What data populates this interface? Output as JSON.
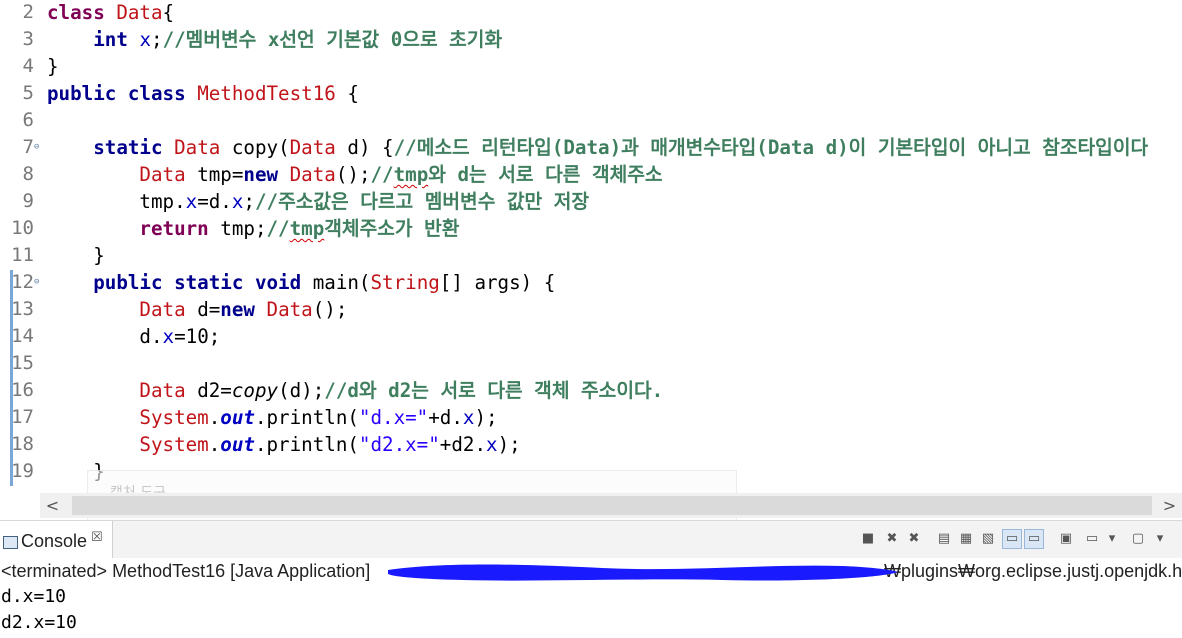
{
  "editor": {
    "lines": [
      {
        "num": "2",
        "parts": [
          {
            "t": "class ",
            "c": "kw"
          },
          {
            "t": "Data",
            "c": "ty"
          },
          {
            "t": "{",
            "c": ""
          }
        ]
      },
      {
        "num": "3",
        "parts": [
          {
            "t": "    ",
            "c": ""
          },
          {
            "t": "int",
            "c": "kwb"
          },
          {
            "t": " ",
            "c": ""
          },
          {
            "t": "x",
            "c": "fld"
          },
          {
            "t": ";",
            "c": ""
          },
          {
            "t": "//멤버변수 x선언 기본값 0으로 초기화",
            "c": "cm"
          }
        ]
      },
      {
        "num": "4",
        "parts": [
          {
            "t": "}",
            "c": ""
          }
        ]
      },
      {
        "num": "5",
        "parts": [
          {
            "t": "public class ",
            "c": "kwb"
          },
          {
            "t": "MethodTest16",
            "c": "ty"
          },
          {
            "t": " {",
            "c": ""
          }
        ]
      },
      {
        "num": "6",
        "parts": []
      },
      {
        "num": "7",
        "fold": true,
        "parts": [
          {
            "t": "    ",
            "c": ""
          },
          {
            "t": "static ",
            "c": "kwb"
          },
          {
            "t": "Data",
            "c": "ty"
          },
          {
            "t": " copy(",
            "c": ""
          },
          {
            "t": "Data",
            "c": "ty"
          },
          {
            "t": " d) {",
            "c": ""
          },
          {
            "t": "//메소드 리턴타입(Data)과 매개변수타입(Data d)이 기본타입이 아니고 참조타입이다",
            "c": "cm"
          }
        ]
      },
      {
        "num": "8",
        "parts": [
          {
            "t": "        ",
            "c": ""
          },
          {
            "t": "Data",
            "c": "ty"
          },
          {
            "t": " tmp=",
            "c": ""
          },
          {
            "t": "new ",
            "c": "kwb"
          },
          {
            "t": "Data",
            "c": "ty"
          },
          {
            "t": "();",
            "c": ""
          },
          {
            "t": "//",
            "c": "cm"
          },
          {
            "t": "tmp",
            "c": "cm squig"
          },
          {
            "t": "와 d는 서로 다른 객체주소",
            "c": "cm"
          }
        ]
      },
      {
        "num": "9",
        "parts": [
          {
            "t": "        tmp.",
            "c": ""
          },
          {
            "t": "x",
            "c": "fld"
          },
          {
            "t": "=d.",
            "c": ""
          },
          {
            "t": "x",
            "c": "fld"
          },
          {
            "t": ";",
            "c": ""
          },
          {
            "t": "//주소값은 다르고 멤버변수 값만 저장",
            "c": "cm"
          }
        ]
      },
      {
        "num": "10",
        "parts": [
          {
            "t": "        ",
            "c": ""
          },
          {
            "t": "return",
            "c": "kw"
          },
          {
            "t": " tmp;",
            "c": ""
          },
          {
            "t": "//",
            "c": "cm"
          },
          {
            "t": "tmp",
            "c": "cm squig"
          },
          {
            "t": "객체주소가 반환",
            "c": "cm"
          }
        ]
      },
      {
        "num": "11",
        "parts": [
          {
            "t": "    }",
            "c": ""
          }
        ]
      },
      {
        "num": "12",
        "fold": true,
        "parts": [
          {
            "t": "    ",
            "c": ""
          },
          {
            "t": "public static void ",
            "c": "kwb"
          },
          {
            "t": "main(",
            "c": ""
          },
          {
            "t": "String",
            "c": "ty"
          },
          {
            "t": "[] args) {",
            "c": ""
          }
        ]
      },
      {
        "num": "13",
        "parts": [
          {
            "t": "        ",
            "c": ""
          },
          {
            "t": "Data",
            "c": "ty"
          },
          {
            "t": " d=",
            "c": ""
          },
          {
            "t": "new ",
            "c": "kwb"
          },
          {
            "t": "Data",
            "c": "ty"
          },
          {
            "t": "();",
            "c": ""
          }
        ]
      },
      {
        "num": "14",
        "parts": [
          {
            "t": "        d.",
            "c": ""
          },
          {
            "t": "x",
            "c": "fld"
          },
          {
            "t": "=10;",
            "c": ""
          }
        ]
      },
      {
        "num": "15",
        "parts": []
      },
      {
        "num": "16",
        "parts": [
          {
            "t": "        ",
            "c": ""
          },
          {
            "t": "Data",
            "c": "ty"
          },
          {
            "t": " d2=",
            "c": ""
          },
          {
            "t": "copy",
            "c": "it"
          },
          {
            "t": "(d);",
            "c": ""
          },
          {
            "t": "//d와 d2는 서로 다른 객체 주소이다.",
            "c": "cm"
          }
        ]
      },
      {
        "num": "17",
        "parts": [
          {
            "t": "        ",
            "c": ""
          },
          {
            "t": "System",
            "c": "ty"
          },
          {
            "t": ".",
            "c": ""
          },
          {
            "t": "out",
            "c": "fldit"
          },
          {
            "t": ".println(",
            "c": ""
          },
          {
            "t": "\"d.x=\"",
            "c": "st"
          },
          {
            "t": "+d.",
            "c": ""
          },
          {
            "t": "x",
            "c": "fld"
          },
          {
            "t": ");",
            "c": ""
          }
        ]
      },
      {
        "num": "18",
        "parts": [
          {
            "t": "        ",
            "c": ""
          },
          {
            "t": "System",
            "c": "ty"
          },
          {
            "t": ".",
            "c": ""
          },
          {
            "t": "out",
            "c": "fldit"
          },
          {
            "t": ".println(",
            "c": ""
          },
          {
            "t": "\"d2.x=\"",
            "c": "st"
          },
          {
            "t": "+d2.",
            "c": ""
          },
          {
            "t": "x",
            "c": "fld"
          },
          {
            "t": ");",
            "c": ""
          }
        ]
      },
      {
        "num": "19",
        "parts": [
          {
            "t": "    }",
            "c": ""
          }
        ]
      }
    ],
    "ghost_text": "캡처 도구"
  },
  "console": {
    "tab_label": "Console",
    "tab_close": "☒",
    "status_left": "<terminated> MethodTest16 [Java Application]",
    "status_right": "₩plugins₩org.eclipse.justj.openjdk.ho",
    "output": [
      "d.x=10",
      "d2.x=10"
    ],
    "redaction_color": "#1a1aff"
  },
  "toolbar": {
    "icons": [
      "terminate-icon",
      "remove-launch-icon",
      "remove-all-launches-icon",
      "clear-console-icon",
      "scroll-lock-icon",
      "word-wrap-icon",
      "show-on-stdout-icon",
      "show-on-stderr-icon",
      "pin-console-icon",
      "display-selected-console-icon",
      "open-console-icon"
    ]
  },
  "scrollbar": {
    "left_arrow": "<",
    "right_arrow": ">"
  }
}
